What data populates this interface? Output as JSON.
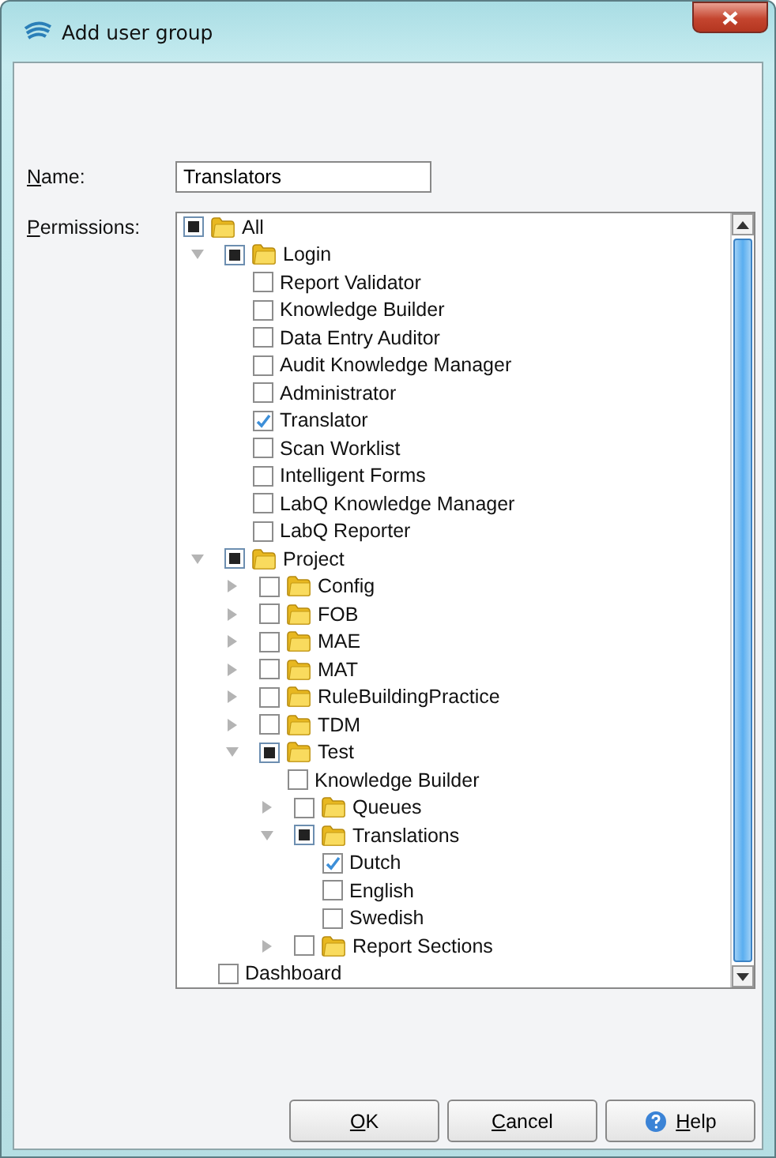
{
  "window": {
    "title": "Add user group"
  },
  "name_field": {
    "label": "Name:",
    "value": "Translators"
  },
  "permissions": {
    "label": "Permissions:",
    "tree": {
      "label": "All",
      "folder": true,
      "checked": false,
      "partial": true,
      "children": [
        {
          "label": "Login",
          "folder": true,
          "checked": false,
          "partial": true,
          "expanded": true,
          "children": [
            {
              "label": "Report Validator",
              "folder": false,
              "checked": false,
              "partial": false
            },
            {
              "label": "Knowledge Builder",
              "folder": false,
              "checked": false,
              "partial": false
            },
            {
              "label": "Data Entry Auditor",
              "folder": false,
              "checked": false,
              "partial": false
            },
            {
              "label": "Audit Knowledge Manager",
              "folder": false,
              "checked": false,
              "partial": false
            },
            {
              "label": "Administrator",
              "folder": false,
              "checked": false,
              "partial": false
            },
            {
              "label": "Translator",
              "folder": false,
              "checked": true,
              "partial": false
            },
            {
              "label": "Scan Worklist",
              "folder": false,
              "checked": false,
              "partial": false
            },
            {
              "label": "Intelligent Forms",
              "folder": false,
              "checked": false,
              "partial": false
            },
            {
              "label": "LabQ Knowledge Manager",
              "folder": false,
              "checked": false,
              "partial": false
            },
            {
              "label": "LabQ Reporter",
              "folder": false,
              "checked": false,
              "partial": false
            }
          ]
        },
        {
          "label": "Project",
          "folder": true,
          "checked": false,
          "partial": true,
          "expanded": true,
          "children": [
            {
              "label": "Config",
              "folder": true,
              "checked": false,
              "partial": false,
              "expanded": false
            },
            {
              "label": "FOB",
              "folder": true,
              "checked": false,
              "partial": false,
              "expanded": false
            },
            {
              "label": "MAE",
              "folder": true,
              "checked": false,
              "partial": false,
              "expanded": false
            },
            {
              "label": "MAT",
              "folder": true,
              "checked": false,
              "partial": false,
              "expanded": false
            },
            {
              "label": "RuleBuildingPractice",
              "folder": true,
              "checked": false,
              "partial": false,
              "expanded": false
            },
            {
              "label": "TDM",
              "folder": true,
              "checked": false,
              "partial": false,
              "expanded": false
            },
            {
              "label": "Test",
              "folder": true,
              "checked": false,
              "partial": true,
              "expanded": true,
              "children": [
                {
                  "label": "Knowledge Builder",
                  "folder": false,
                  "checked": false,
                  "partial": false
                },
                {
                  "label": "Queues",
                  "folder": true,
                  "checked": false,
                  "partial": false,
                  "expanded": false
                },
                {
                  "label": "Translations",
                  "folder": true,
                  "checked": false,
                  "partial": true,
                  "expanded": true,
                  "children": [
                    {
                      "label": "Dutch",
                      "folder": false,
                      "checked": true,
                      "partial": false
                    },
                    {
                      "label": "English",
                      "folder": false,
                      "checked": false,
                      "partial": false
                    },
                    {
                      "label": "Swedish",
                      "folder": false,
                      "checked": false,
                      "partial": false
                    }
                  ]
                },
                {
                  "label": "Report Sections",
                  "folder": true,
                  "checked": false,
                  "partial": false,
                  "expanded": false
                }
              ]
            }
          ]
        },
        {
          "label": "Dashboard",
          "folder": false,
          "checked": false,
          "partial": false
        }
      ]
    }
  },
  "buttons": [
    {
      "label": "OK",
      "kind": "plain"
    },
    {
      "label": "Cancel",
      "kind": "plain"
    },
    {
      "label": "Help",
      "kind": "help"
    }
  ]
}
